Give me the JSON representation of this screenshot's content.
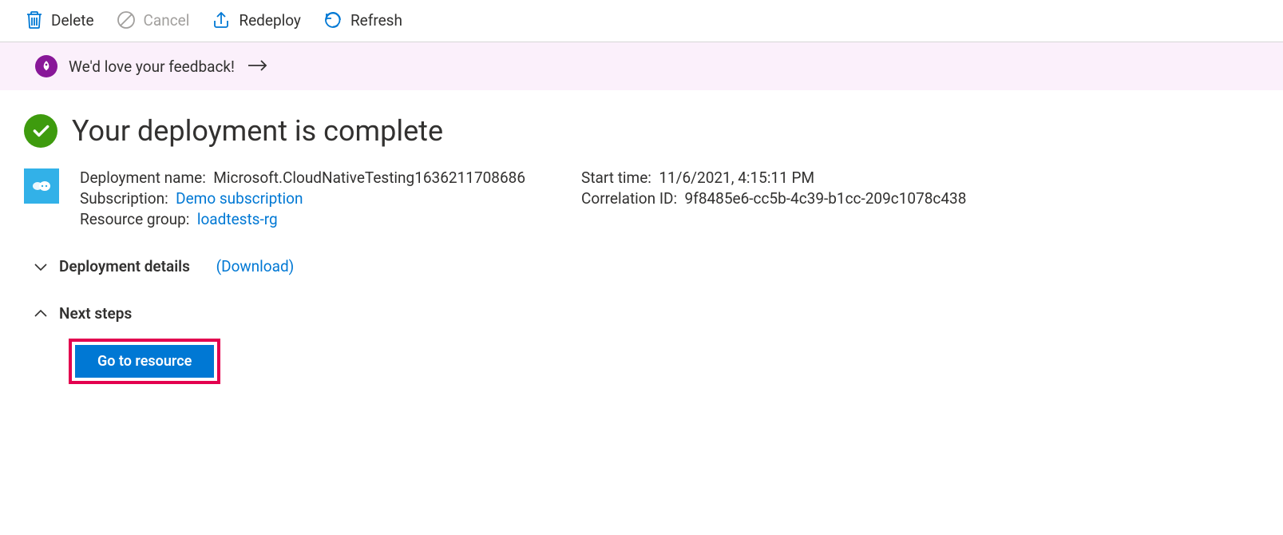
{
  "toolbar": {
    "delete": "Delete",
    "cancel": "Cancel",
    "redeploy": "Redeploy",
    "refresh": "Refresh"
  },
  "feedback": {
    "text": "We'd love your feedback!"
  },
  "header": {
    "title": "Your deployment is complete"
  },
  "details": {
    "deployment_name_label": "Deployment name:",
    "deployment_name_value": "Microsoft.CloudNativeTesting1636211708686",
    "subscription_label": "Subscription:",
    "subscription_value": "Demo subscription",
    "resource_group_label": "Resource group:",
    "resource_group_value": "loadtests-rg",
    "start_time_label": "Start time:",
    "start_time_value": "11/6/2021, 4:15:11 PM",
    "correlation_id_label": "Correlation ID:",
    "correlation_id_value": "9f8485e6-cc5b-4c39-b1cc-209c1078c438"
  },
  "sections": {
    "deployment_details": "Deployment details",
    "download": "(Download)",
    "next_steps": "Next steps"
  },
  "actions": {
    "go_to_resource": "Go to resource"
  }
}
